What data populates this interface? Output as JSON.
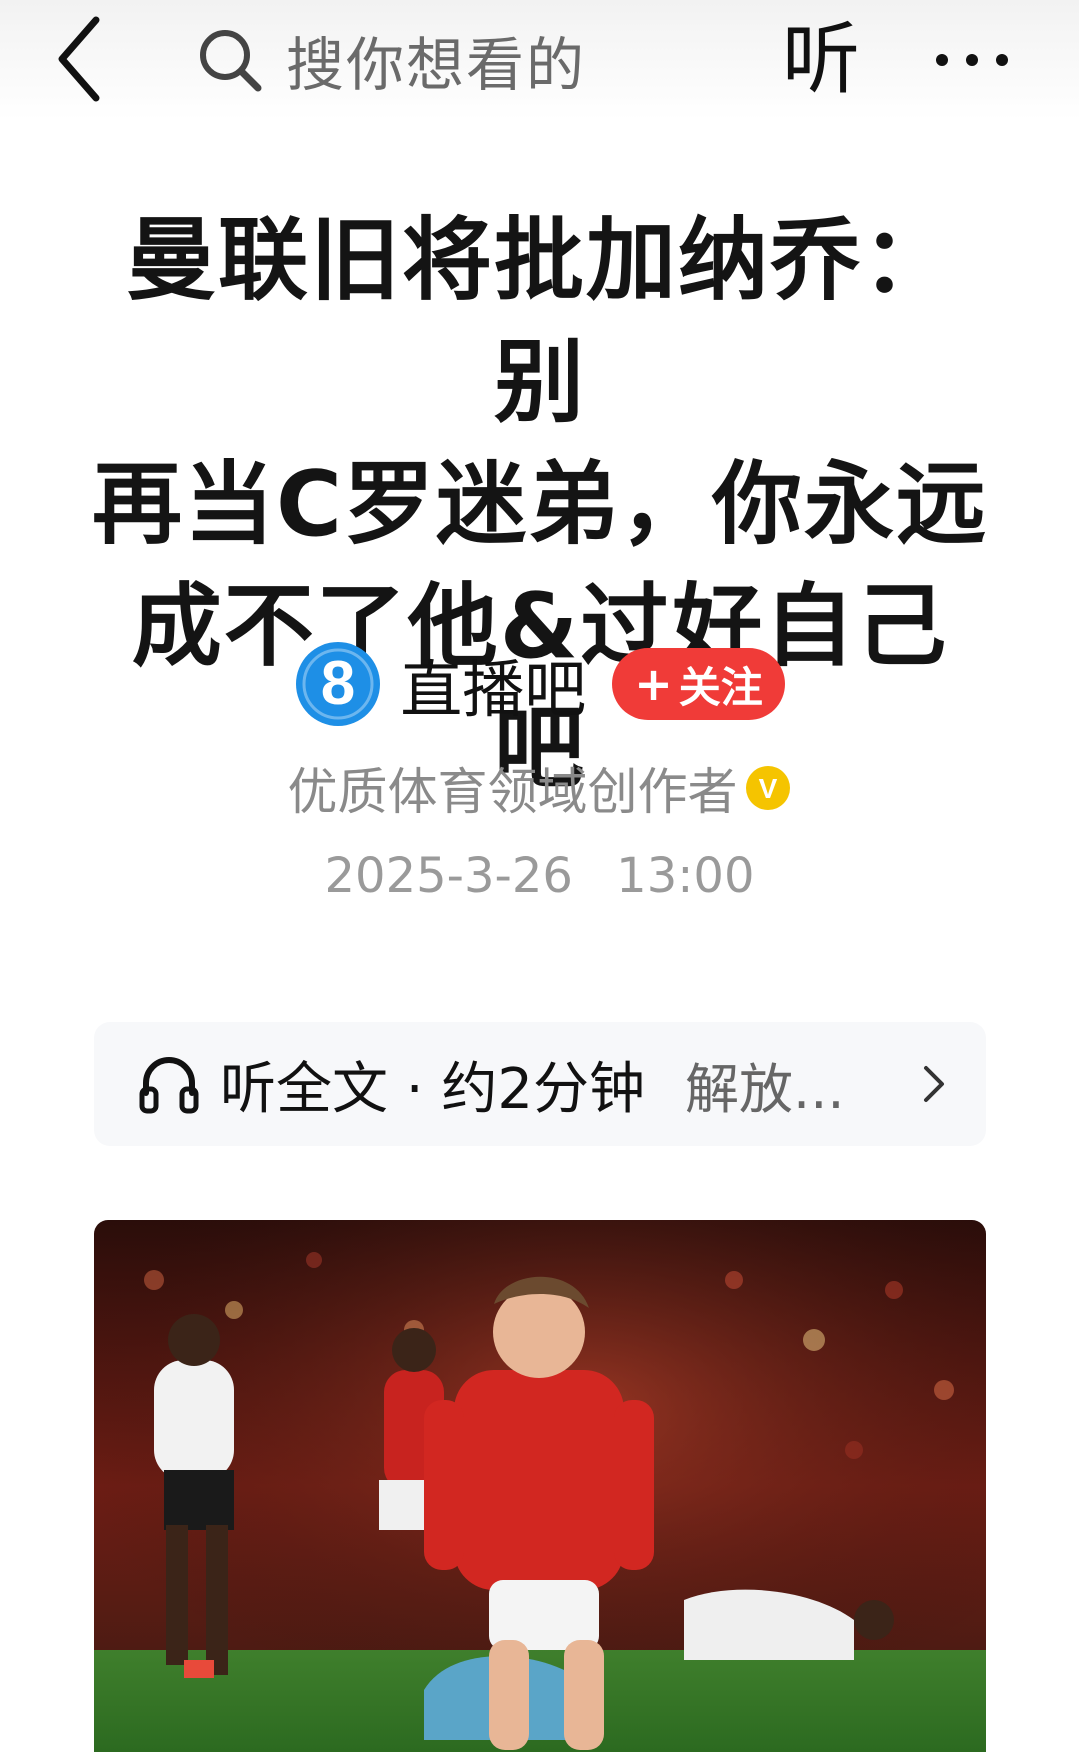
{
  "topbar": {
    "search_placeholder": "搜你想看的",
    "listen_label": "听"
  },
  "article": {
    "title_lines": [
      "曼联旧将批加纳乔：别",
      "再当C罗迷弟，你永远",
      "成不了他&过好自己吧"
    ]
  },
  "author": {
    "avatar_glyph": "8",
    "name": "直播吧",
    "follow_plus": "+",
    "follow_label": "关注",
    "description": "优质体育领域创作者",
    "verified_glyph": "V"
  },
  "publish": {
    "date": "2025-3-26",
    "time": "13:00"
  },
  "listen_bar": {
    "label": "听全文 · 约2分钟",
    "voice": "解放..."
  },
  "colors": {
    "follow_red": "#f03b38",
    "avatar_blue": "#1e8fe6",
    "verified_yellow": "#f5c400"
  },
  "icons": [
    "chevron-left-icon",
    "search-icon",
    "more-dots-icon",
    "verified-icon",
    "headphone-icon",
    "chevron-right-icon"
  ]
}
